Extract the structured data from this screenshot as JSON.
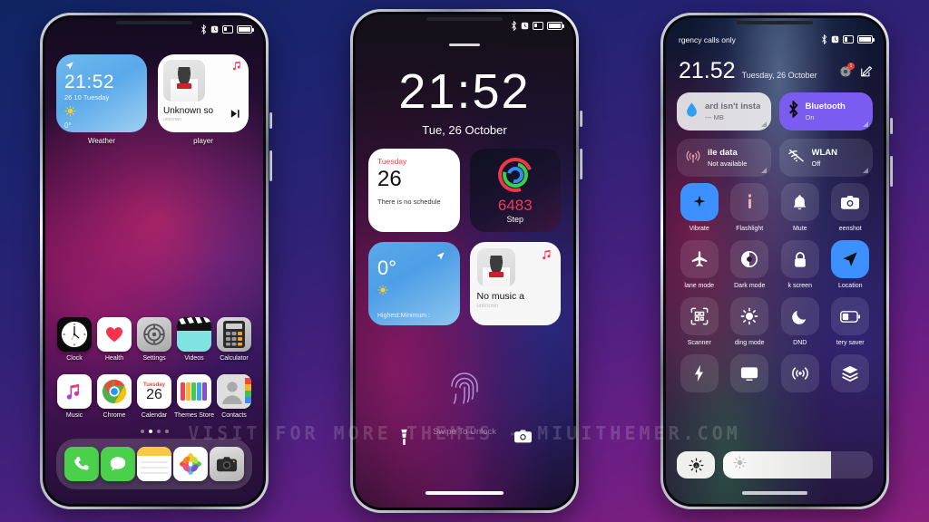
{
  "watermark": "VISIT FOR MORE THEMES - MIUITHEMER.COM",
  "background": {
    "top_color": "#0f2463",
    "bottom_color": "#8b1f7e"
  },
  "status_icons": [
    "bluetooth-icon",
    "alarm-icon",
    "sim-icon",
    "battery-icon"
  ],
  "phone1": {
    "name": "Home screen",
    "widgets": [
      {
        "label": "Weather",
        "time": "21:52",
        "date": "26 10 Tuesday",
        "temperature": "0°",
        "condition_icon": "sun-icon",
        "location_icon": "location-arrow-icon"
      },
      {
        "label": "player",
        "title": "Unknown so",
        "subtitle": "unknown",
        "note_icon": "music-note-icon",
        "play_icon": "play-next-icon"
      }
    ],
    "apps": [
      {
        "name": "Clock",
        "icon": "clock-icon"
      },
      {
        "name": "Health",
        "icon": "heart-icon"
      },
      {
        "name": "Settings",
        "icon": "gear-icon"
      },
      {
        "name": "Videos",
        "icon": "clapperboard-icon"
      },
      {
        "name": "Calculator",
        "icon": "calculator-icon"
      },
      {
        "name": "Music",
        "icon": "music-note-icon"
      },
      {
        "name": "Chrome",
        "icon": "chrome-icon"
      },
      {
        "name": "Calendar",
        "icon": "calendar-icon",
        "cal_day": "Tuesday",
        "cal_num": "26"
      },
      {
        "name": "Themes Store",
        "icon": "themes-icon"
      },
      {
        "name": "Contacts",
        "icon": "contacts-icon"
      }
    ],
    "page_dots": {
      "count": 4,
      "active_index": 1
    },
    "dock": [
      {
        "name": "Phone",
        "icon": "phone-icon"
      },
      {
        "name": "Messages",
        "icon": "message-bubble-icon"
      },
      {
        "name": "Notes",
        "icon": "notes-icon"
      },
      {
        "name": "Photos",
        "icon": "photos-icon"
      },
      {
        "name": "Camera",
        "icon": "camera-icon"
      }
    ]
  },
  "phone2": {
    "name": "Lock screen",
    "clock": {
      "time": "21:52",
      "date": "Tue, 26 October"
    },
    "calendar_widget": {
      "day": "Tuesday",
      "date_number": "26",
      "note": "There is no schedule"
    },
    "step_widget": {
      "value": "6483",
      "label": "Step",
      "icon": "activity-rings-icon"
    },
    "weather_widget": {
      "temperature": "0°",
      "hi_lo": "Highest:Minimum :",
      "condition_icon": "sun-icon",
      "location_icon": "location-arrow-icon"
    },
    "music_widget": {
      "title": "No music a",
      "subtitle": "unknown",
      "note_icon": "music-note-icon"
    },
    "unlock_hint": "Swipe To Unlock",
    "fingerprint_icon": "fingerprint-icon",
    "shortcuts": [
      {
        "name": "Flashlight",
        "icon": "flashlight-icon"
      },
      {
        "name": "Camera",
        "icon": "camera-icon"
      }
    ]
  },
  "phone3": {
    "name": "Control center",
    "carrier": "rgency calls only",
    "time": "21.52",
    "date": "Tuesday, 26 October",
    "header_icons": [
      {
        "name": "settings-shortcut-icon",
        "badge": "1"
      },
      {
        "name": "edit-icon",
        "badge": ""
      }
    ],
    "big_tiles": [
      {
        "title": "ard isn't insta",
        "sub": "--- MB",
        "icon": "data-drop-icon",
        "style": "light"
      },
      {
        "title": "Bluetooth",
        "sub": "On",
        "icon": "bluetooth-icon",
        "style": "accent"
      },
      {
        "title": "ile data",
        "sub": "Not available",
        "icon": "cell-signal-icon",
        "style": "dim"
      },
      {
        "title": "WLAN",
        "sub": "Off",
        "icon": "wifi-off-icon",
        "style": "dim"
      }
    ],
    "tiles": [
      {
        "name": "Vibrate",
        "icon": "vibrate-icon",
        "active": true
      },
      {
        "name": "Flashlight",
        "icon": "flashlight-icon",
        "active": false
      },
      {
        "name": "Mute",
        "icon": "bell-icon",
        "active": false
      },
      {
        "name": "eenshot",
        "icon": "camera-icon",
        "active": false
      },
      {
        "name": "lane mode",
        "icon": "airplane-icon",
        "active": false
      },
      {
        "name": "Dark mode",
        "icon": "contrast-icon",
        "active": false
      },
      {
        "name": "k screen",
        "icon": "lock-icon",
        "active": false
      },
      {
        "name": "Location",
        "icon": "location-arrow-icon",
        "active": true
      },
      {
        "name": "Scanner",
        "icon": "qr-scan-icon",
        "active": false
      },
      {
        "name": "ding mode",
        "icon": "reading-sun-icon",
        "active": false
      },
      {
        "name": "DND",
        "icon": "moon-icon",
        "active": false
      },
      {
        "name": "tery saver",
        "icon": "battery-saver-icon",
        "active": false
      },
      {
        "name": "",
        "icon": "bolt-icon",
        "active": false
      },
      {
        "name": "",
        "icon": "cast-screen-icon",
        "active": false
      },
      {
        "name": "",
        "icon": "nfc-broadcast-icon",
        "active": false
      },
      {
        "name": "",
        "icon": "layers-icon",
        "active": false
      }
    ],
    "brightness": {
      "auto_icon": "auto-brightness-icon",
      "slider_icon": "sun-icon",
      "level_percent": 72
    }
  }
}
